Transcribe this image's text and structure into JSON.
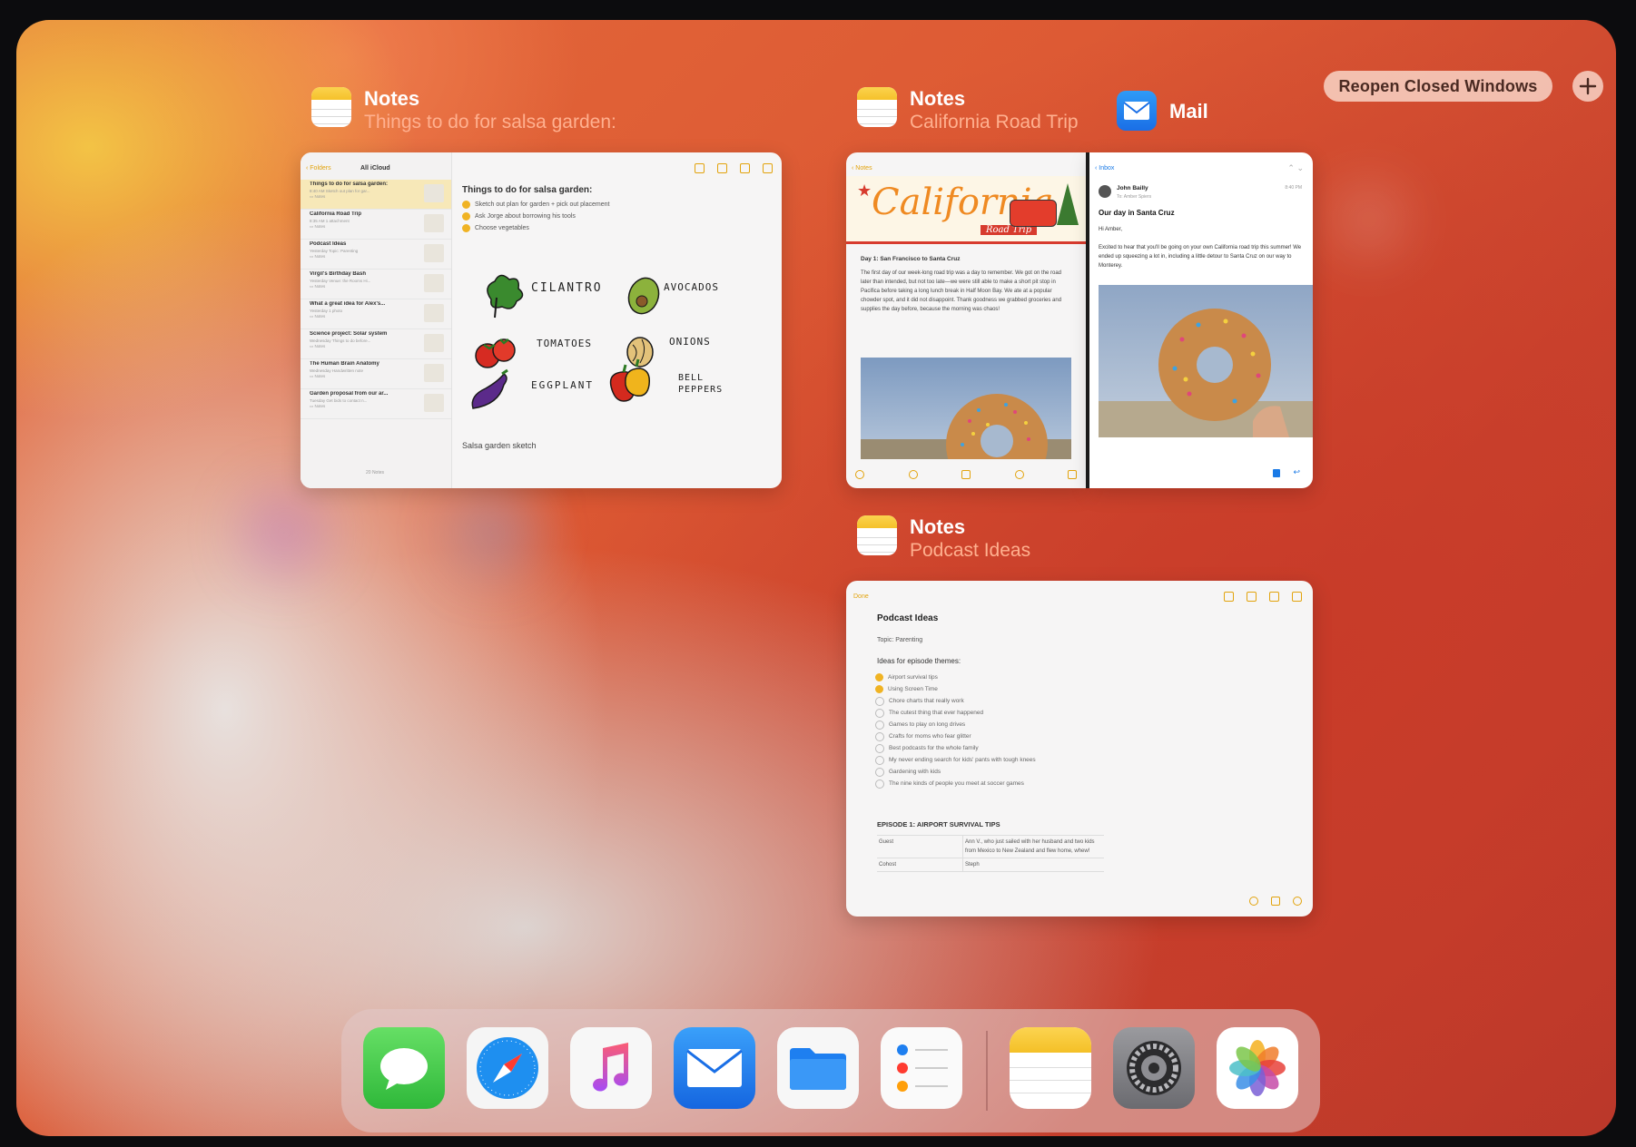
{
  "reopen_button": "Reopen Closed Windows",
  "windows": {
    "notes_salsa": {
      "app": "Notes",
      "title": "Things to do for salsa garden:"
    },
    "notes_california": {
      "app": "Notes",
      "title": "California Road Trip"
    },
    "mail": {
      "app": "Mail"
    },
    "notes_podcast": {
      "app": "Notes",
      "title": "Podcast Ideas"
    }
  },
  "salsa_card": {
    "back": "Folders",
    "list_header": "All iCloud",
    "notes": [
      {
        "title": "Things to do for salsa garden:",
        "sub": "8:40 AM  Sketch out plan for gar...",
        "folder": "Notes"
      },
      {
        "title": "California Road Trip",
        "sub": "8:35 AM  1 attachment",
        "folder": "Notes"
      },
      {
        "title": "Podcast Ideas",
        "sub": "Yesterday  Topic: Parenting",
        "folder": "Notes"
      },
      {
        "title": "Virgil's Birthday Bash",
        "sub": "Yesterday  Venue: the Rooms Hi...",
        "folder": "Notes"
      },
      {
        "title": "What a great idea for Alex's...",
        "sub": "Yesterday  1 photo",
        "folder": "Notes"
      },
      {
        "title": "Science project: Solar system",
        "sub": "Wednesday  Things to do before...",
        "folder": "Notes"
      },
      {
        "title": "The Human Brain Anatomy",
        "sub": "Wednesday  Handwritten note",
        "folder": "Notes"
      },
      {
        "title": "Garden proposal from our ar...",
        "sub": "Tuesday  Get bids to contact n...",
        "folder": "Notes"
      }
    ],
    "count": "20 Notes",
    "heading": "Things to do for salsa garden:",
    "todos": [
      "Sketch out plan for garden + pick out placement",
      "Ask Jorge about borrowing his tools",
      "Choose vegetables"
    ],
    "veg": [
      "CILANTRO",
      "AVOCADOS",
      "TOMATOES",
      "ONIONS",
      "EGGPLANT",
      "BELL PEPPERS"
    ],
    "caption": "Salsa garden sketch"
  },
  "california_card": {
    "back": "Notes",
    "banner": "California",
    "banner_sub": "Road Trip",
    "heading": "Day 1: San Francisco to Santa Cruz",
    "body": "The first day of our week-long road trip was a day to remember. We got on the road later than intended, but not too late—we were still able to make a short pit stop in Pacifica before taking a long lunch break in Half Moon Bay. We ate at a popular chowder spot, and it did not disappoint. Thank goodness we grabbed groceries and supplies the day before, because the morning was chaos!"
  },
  "mail_card": {
    "back": "Inbox",
    "sender": "John Bailly",
    "to": "To: Amber Spiers",
    "time": "8:40 PM",
    "subject": "Our day in Santa Cruz",
    "greeting": "Hi Amber,",
    "body": "Excited to hear that you'll be going on your own California road trip this summer! We ended up squeezing a lot in, including a little detour to Santa Cruz on our way to Monterey."
  },
  "podcast_card": {
    "back": "Done",
    "title": "Podcast Ideas",
    "topic": "Topic: Parenting",
    "themes_heading": "Ideas for episode themes:",
    "themes": [
      {
        "text": "Airport survival tips",
        "done": true
      },
      {
        "text": "Using Screen Time",
        "done": true
      },
      {
        "text": "Chore charts that really work",
        "done": false
      },
      {
        "text": "The cutest thing that ever happened",
        "done": false
      },
      {
        "text": "Games to play on long drives",
        "done": false
      },
      {
        "text": "Crafts for moms who fear glitter",
        "done": false
      },
      {
        "text": "Best podcasts for the whole family",
        "done": false
      },
      {
        "text": "My never ending search for kids' pants with tough knees",
        "done": false
      },
      {
        "text": "Gardening with kids",
        "done": false
      },
      {
        "text": "The nine kinds of people you meet at soccer games",
        "done": false
      }
    ],
    "episode": "EPISODE 1: AIRPORT SURVIVAL TIPS",
    "table": [
      {
        "k": "Guest",
        "v": "Ann V., who just sailed with her husband and two kids from Mexico to New Zealand and flew home, whew!"
      },
      {
        "k": "Cohost",
        "v": "Steph"
      }
    ]
  },
  "dock": [
    "messages-icon",
    "safari-icon",
    "music-icon",
    "mail-icon",
    "files-icon",
    "reminders-icon",
    "notes-icon",
    "settings-icon",
    "photos-icon"
  ]
}
